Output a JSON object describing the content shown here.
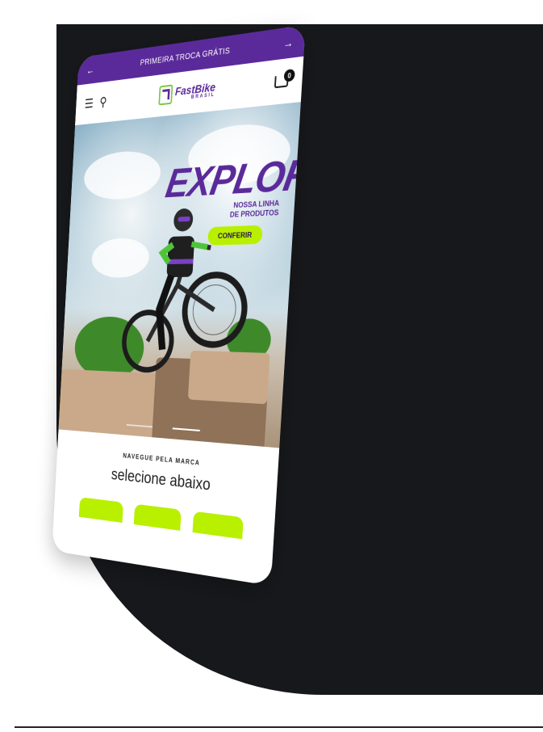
{
  "announcement": {
    "prev_icon": "arrow-left-icon",
    "text": "PRIMEIRA TROCA GRÁTIS",
    "next_icon": "arrow-right-icon"
  },
  "header": {
    "menu_icon": "menu-icon",
    "search_icon": "search-icon",
    "logo": {
      "brand": "FastBike",
      "sub": "BRASIL"
    },
    "cart_icon": "cart-icon",
    "cart_count": "0"
  },
  "hero": {
    "title": "EXPLORE",
    "subtitle_line1": "NOSSA LINHA",
    "subtitle_line2": "DE PRODUTOS",
    "cta_label": "CONFERIR",
    "slide_count": 2,
    "active_slide": 2
  },
  "brands": {
    "kicker": "NAVEGUE PELA MARCA",
    "title": "selecione abaixo"
  },
  "colors": {
    "purple": "#5b2a9a",
    "lime": "#b8f000",
    "dark_bg": "#17181b"
  }
}
